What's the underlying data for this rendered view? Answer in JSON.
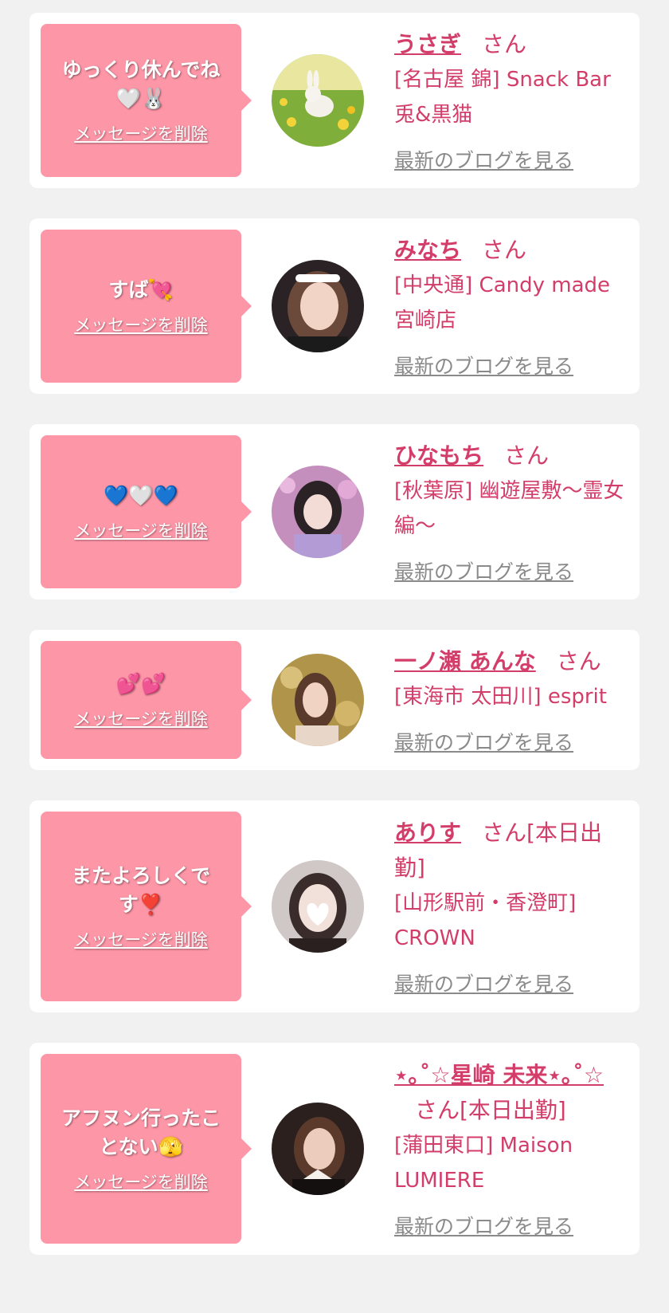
{
  "colors": {
    "bubble": "#fd96a7",
    "accent": "#d33d69",
    "link_gray": "#8a8a8a",
    "background": "#f1f1f1"
  },
  "delete_label": "メッセージを削除",
  "blog_label": "最新のブログを見る",
  "entries": [
    {
      "message": "ゆっくり休んでね\n🤍🐰",
      "name": "うさぎ",
      "suffix": "さん",
      "shop": "[名古屋 錦] Snack Bar 兎&黒猫",
      "avatar_icon": "rabbit-photo"
    },
    {
      "message": "すば💘",
      "name": "みなち",
      "suffix": "さん",
      "shop": "[中央通] Candy made 宮崎店",
      "avatar_icon": "person-photo"
    },
    {
      "message": "💙🤍💙",
      "name": "ひなもち",
      "suffix": "さん",
      "shop": "[秋葉原] 幽遊屋敷〜霊女編〜",
      "avatar_icon": "person-photo"
    },
    {
      "message": "💕💕",
      "name": "一ノ瀬 あんな",
      "suffix": "さん",
      "shop": "[東海市 太田川] esprit",
      "avatar_icon": "person-photo"
    },
    {
      "message": "またよろしくで\nす❣️",
      "name": "ありす",
      "suffix": "さん[本日出勤]",
      "shop": "[山形駅前・香澄町] CROWN",
      "avatar_icon": "person-photo"
    },
    {
      "message": "アフヌン行ったこ\nとない🫣",
      "name": "⋆｡˚☆星崎 未来⋆｡˚☆",
      "suffix": "さん[本日出勤]",
      "shop": "[蒲田東口] Maison LUMIERE",
      "avatar_icon": "person-photo"
    }
  ]
}
